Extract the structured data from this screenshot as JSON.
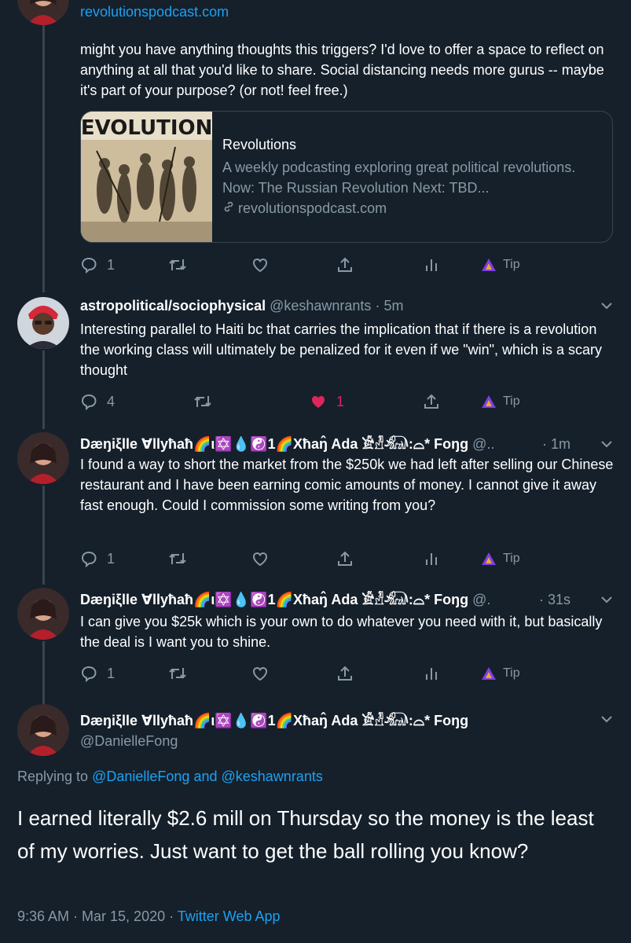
{
  "top_tweet": {
    "domain_line": "revolutionspodcast.com",
    "text": "might you have anything thoughts this triggers? I'd love to offer a space to reflect on anything at all that you'd like to share. Social distancing needs more gurus -- maybe it's part of your purpose? (or not! feel free.)",
    "card": {
      "image_title": "REVOLUTIONS",
      "title": "Revolutions",
      "description": "A weekly podcasting exploring great political revolutions. Now: The Russian Revolution Next: TBD...",
      "domain": "revolutionspodcast.com"
    },
    "actions": {
      "replies": "1",
      "retweets": "",
      "likes": "",
      "tip": "Tip"
    }
  },
  "tweets": [
    {
      "name": "astropolitical/sociophysical",
      "handle": "@keshawnrants",
      "dot": "·",
      "time": "5m",
      "text": "Interesting parallel to Haiti bc that carries the implication that if there is a revolution the working class will ultimately be penalized for it even if we \"win\", which is a scary thought",
      "actions": {
        "replies": "4",
        "retweets": "",
        "likes": "1",
        "tip": "Tip"
      }
    },
    {
      "name": "Dæŋiξlle ∀llyħaħ🌈ι✡️💧☯️1🌈Xħaŋ̂ Ada 𓀀𓁐𓃰:⌓* Foŋg",
      "handle": "@..",
      "dot": "·",
      "time": "1m",
      "text": "I found a way to short the market from the $250k we had left after selling our Chinese restaurant and I have been earning comic amounts of money. I cannot give it away fast enough. Could I commission some writing from you?",
      "actions": {
        "replies": "1",
        "retweets": "",
        "likes": "",
        "tip": "Tip"
      }
    },
    {
      "name": "Dæŋiξlle ∀llyħaħ🌈ι✡️💧☯️1🌈Xħaŋ̂ Ada 𓀀𓁐𓃰:⌓* Foŋg",
      "handle": "@.",
      "dot": "·",
      "time": "31s",
      "text": "I can give you $25k which is your own to do whatever you need with it, but basically the deal is I want you to shine.",
      "actions": {
        "replies": "1",
        "retweets": "",
        "likes": "",
        "tip": "Tip"
      }
    }
  ],
  "main_tweet": {
    "name": "Dæŋiξlle ∀llyħaħ🌈ι✡️💧☯️1🌈Xħaŋ̂ Ada 𓀀𓁐𓃰:⌓* Foŋg",
    "handle": "@DanielleFong",
    "replying_prefix": "Replying to",
    "replying_user1": "@DanielleFong",
    "replying_and": "and",
    "replying_user2": "@keshawnrants",
    "text": "I earned literally $2.6 mill on Thursday so the money is the least of my worries. Just want to get the ball rolling you know?",
    "timestamp": "9:36 AM · Mar 15, 2020 ·",
    "source": "Twitter Web App"
  },
  "colors": {
    "background": "#15202b",
    "secondary": "#8899a6",
    "link": "#1da1f2",
    "like": "#e0245e",
    "tip": "#7b3fe4"
  }
}
